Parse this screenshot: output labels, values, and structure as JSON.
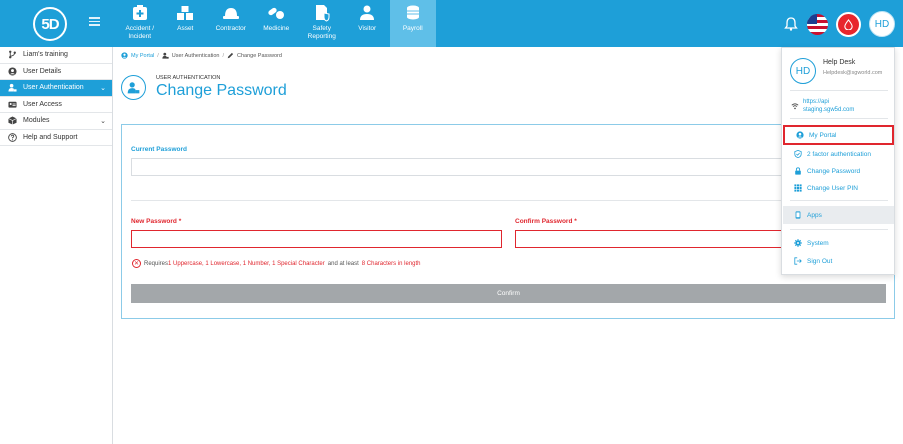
{
  "brand": {
    "logo_text": "5D"
  },
  "nav_modules": [
    {
      "label": "Accident /\nIncident",
      "icon": "accident-icon"
    },
    {
      "label": "Asset",
      "icon": "asset-icon"
    },
    {
      "label": "Contractor",
      "icon": "hardhat-icon"
    },
    {
      "label": "Medicine",
      "icon": "pills-icon"
    },
    {
      "label": "Safety\nReporting",
      "icon": "safety-report-icon"
    },
    {
      "label": "Visitor",
      "icon": "visitor-icon"
    },
    {
      "label": "Payroll",
      "icon": "coins-icon"
    }
  ],
  "header_right": {
    "avatar_initials": "HD"
  },
  "sidebar": {
    "items": [
      {
        "label": "Liam's training",
        "icon": "branch-icon"
      },
      {
        "label": "User Details",
        "icon": "user-circle-icon"
      },
      {
        "label": "User Authentication",
        "icon": "user-lock-icon"
      },
      {
        "label": "User Access",
        "icon": "id-card-icon"
      },
      {
        "label": "Modules",
        "icon": "box-icon"
      },
      {
        "label": "Help and Support",
        "icon": "question-icon"
      }
    ]
  },
  "breadcrumb": {
    "home": "My Portal",
    "section": "User Authentication",
    "page": "Change Password"
  },
  "page": {
    "kicker": "USER AUTHENTICATION",
    "title": "Change Password"
  },
  "form": {
    "current_password_label": "Current Password",
    "new_password_label": "New Password",
    "confirm_password_label": "Confirm Password",
    "required_mark": "*",
    "requires_prefix": "Requires",
    "requires_rules": "1 Uppercase, 1 Lowercase, 1 Number, 1 Special Character",
    "requires_mid": "and at least",
    "requires_length": "8 Characters in length",
    "confirm_button": "Confirm"
  },
  "profile_menu": {
    "avatar": "HD",
    "name": "Help Desk",
    "email": "Helpdesk@sgworld.com",
    "api_line1": "https://api",
    "api_line2": "staging.sgw5d.com",
    "items": [
      {
        "label": "My Portal",
        "icon": "user-circle-icon"
      },
      {
        "label": "2 factor authentication",
        "icon": "shield-check-icon"
      },
      {
        "label": "Change Password",
        "icon": "lock-icon"
      },
      {
        "label": "Change User PIN",
        "icon": "keypad-icon"
      },
      {
        "label": "Apps",
        "icon": "mobile-icon"
      },
      {
        "label": "System",
        "icon": "gear-icon"
      },
      {
        "label": "Sign Out",
        "icon": "sign-out-icon"
      }
    ]
  },
  "colors": {
    "primary": "#1e9fd8",
    "danger": "#e0262e",
    "button_disabled": "#a3a7aa"
  }
}
